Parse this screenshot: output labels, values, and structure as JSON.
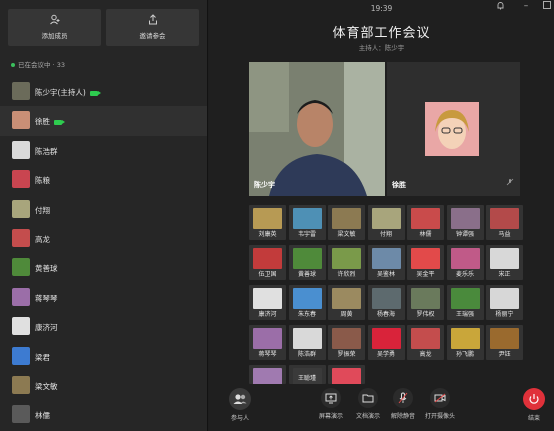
{
  "left": {
    "add_member": "添加成员",
    "invite": "邀请参会",
    "status": "已在会议中 · 33",
    "participants": [
      {
        "name": "陈少宇(主持人)",
        "camera": true,
        "color": "#6b6b5a"
      },
      {
        "name": "徐胜",
        "camera": true,
        "color": "#c98f76"
      },
      {
        "name": "陈浩群",
        "camera": false,
        "color": "#d9d9d9"
      },
      {
        "name": "陈粮",
        "camera": false,
        "color": "#c94550"
      },
      {
        "name": "付翔",
        "camera": false,
        "color": "#a8a57c"
      },
      {
        "name": "高龙",
        "camera": false,
        "color": "#c44d4d"
      },
      {
        "name": "黄善球",
        "camera": false,
        "color": "#4f8a3a"
      },
      {
        "name": "蒋琴琴",
        "camera": false,
        "color": "#9b6ea8"
      },
      {
        "name": "康济河",
        "camera": false,
        "color": "#e0e0e0"
      },
      {
        "name": "梁君",
        "camera": false,
        "color": "#3d7bd1"
      },
      {
        "name": "梁文敏",
        "camera": false,
        "color": "#8c7a52"
      },
      {
        "name": "林儒",
        "camera": false,
        "color": "#5a5a5a"
      }
    ]
  },
  "right": {
    "time": "19:39",
    "title": "体育部工作会议",
    "host": "主持人：陈少宇",
    "main_speaker": "陈少宇",
    "second_speaker": "徐胜",
    "grid": [
      {
        "name": "刘康英",
        "color": "#b79a54"
      },
      {
        "name": "韦宇雷",
        "color": "#4e90b5"
      },
      {
        "name": "梁文敏",
        "color": "#8c7a52"
      },
      {
        "name": "付翔",
        "color": "#a8a57c"
      },
      {
        "name": "林儒",
        "color": "#c94b4b"
      },
      {
        "name": "钟谭强",
        "color": "#8a6f8a"
      },
      {
        "name": "马益",
        "color": "#b34a4a"
      },
      {
        "name": "伍卫国",
        "color": "#c23b3b"
      },
      {
        "name": "黄善球",
        "color": "#4f8a3a"
      },
      {
        "name": "许欣烈",
        "color": "#7a9a4a"
      },
      {
        "name": "吴鉴林",
        "color": "#6d8aa8"
      },
      {
        "name": "吴金平",
        "color": "#e24a4a"
      },
      {
        "name": "麦乐乐",
        "color": "#c05a88"
      },
      {
        "name": "宋正",
        "color": "#d8d8d8"
      },
      {
        "name": "康济河",
        "color": "#e0e0e0"
      },
      {
        "name": "朱东春",
        "color": "#4a8fd0"
      },
      {
        "name": "周黄",
        "color": "#9b8a60"
      },
      {
        "name": "杨春海",
        "color": "#5d6a6e"
      },
      {
        "name": "罗伟权",
        "color": "#6a7a5c"
      },
      {
        "name": "王瑞强",
        "color": "#4a8a3c"
      },
      {
        "name": "杨丽宁",
        "color": "#d7d7d7"
      },
      {
        "name": "蒋琴琴",
        "color": "#9b6ea8"
      },
      {
        "name": "陈浩群",
        "color": "#d9d9d9"
      },
      {
        "name": "罗振荣",
        "color": "#8a5a4a"
      },
      {
        "name": "吴学勇",
        "color": "#d9233a"
      },
      {
        "name": "高龙",
        "color": "#c44d4d"
      },
      {
        "name": "孙飞鹏",
        "color": "#c9a63a"
      },
      {
        "name": "尹钰",
        "color": "#9a6a2e"
      },
      {
        "name": "",
        "color": "#a07ab0"
      },
      {
        "name": "王聪瑾",
        "color": "#3a3a3a"
      },
      {
        "name": "",
        "color": "#e04a5a"
      }
    ]
  },
  "toolbar": {
    "participants": "参与人",
    "screen_share": "屏幕演示",
    "doc_share": "文档演示",
    "unmute": "解除静音",
    "camera_on": "打开摄像头",
    "end": "结束"
  }
}
